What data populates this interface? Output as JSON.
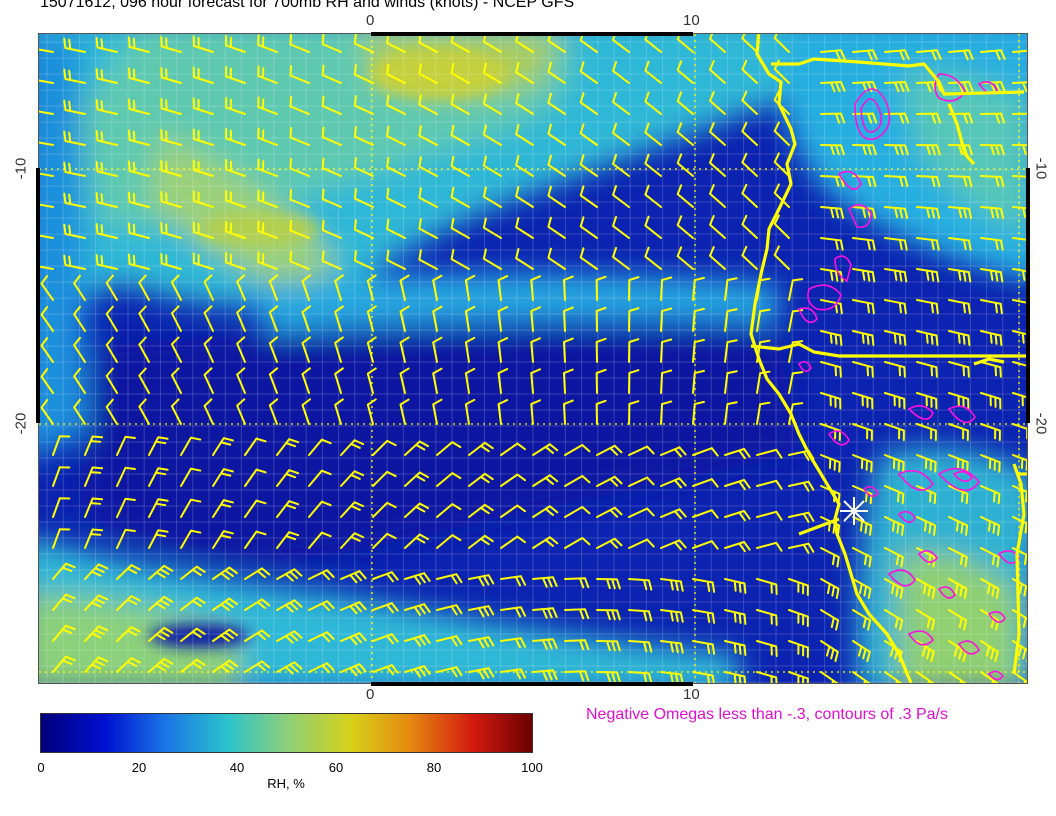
{
  "title": "15071612, 096 hour forecast for 700mb RH and winds (knots) - NCEP GFS",
  "map": {
    "top_ticks": [
      "0",
      "10"
    ],
    "bottom_ticks": [
      "0",
      "10"
    ],
    "left_ticks": [
      "-10",
      "-20"
    ],
    "right_ticks": [
      "-10",
      "-20"
    ],
    "barb_color": "#ffff00",
    "coast_color": "#ffff00",
    "omega_color": "#ff10e0",
    "marker": "station-star-icon"
  },
  "omega_note": "Negative Omegas less than -.3, contours of .3 Pa/s",
  "colorbar": {
    "labels": [
      "0",
      "20",
      "40",
      "60",
      "80",
      "100"
    ],
    "title": "RH, %",
    "colors": [
      "#00007a",
      "#0010d0",
      "#1a72e6",
      "#2cc4cc",
      "#8ccf7a",
      "#d6d21a",
      "#e58a10",
      "#d21a10",
      "#6a0000"
    ]
  }
}
